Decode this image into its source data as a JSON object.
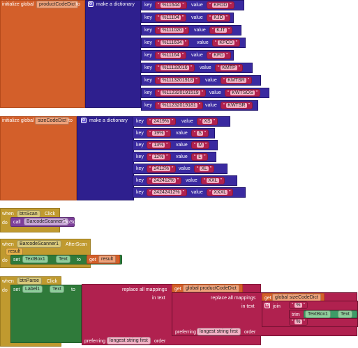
{
  "block1": {
    "initialize": "initialize global",
    "var_name": "productCodeDict",
    "to": "to",
    "make_dict": "make a dictionary",
    "pairs": [
      {
        "key": "%11644",
        "value": "KFDD"
      },
      {
        "key": "%11104",
        "value": "KJD"
      },
      {
        "key": "%111020",
        "value": "KJT"
      },
      {
        "key": "%111634",
        "value": "KPCD"
      },
      {
        "key": "%11164",
        "value": "KFD"
      },
      {
        "key": "%11132016",
        "value": "KMTP"
      },
      {
        "key": "%1113201918",
        "value": "KMTSR"
      },
      {
        "key": "%112320191519",
        "value": "KWTSOS"
      },
      {
        "key": "%11232019181",
        "value": "KWTSR"
      }
    ]
  },
  "block2": {
    "initialize": "initialize global",
    "var_name": "sizeCodeDict",
    "to": "to",
    "make_dict": "make a dictionary",
    "pairs": [
      {
        "key": "2419%",
        "value": "XS"
      },
      {
        "key": "19%",
        "value": "S"
      },
      {
        "key": "13%",
        "value": "M"
      },
      {
        "key": "12%",
        "value": "L"
      },
      {
        "key": "2412%",
        "value": "XL"
      },
      {
        "key": "242412%",
        "value": "XXL"
      },
      {
        "key": "24242412%",
        "value": "XXXL"
      }
    ]
  },
  "labels": {
    "key": "key",
    "value": "value"
  },
  "block3": {
    "when": "when",
    "component": "btnScan",
    "event": "Click",
    "do": "do",
    "call": "call",
    "scanner": "BarcodeScanner1",
    "method": "DoScan"
  },
  "block4": {
    "when": "when",
    "component": "BarcodeScanner1",
    "event": "AfterScan",
    "param": "result",
    "do": "do",
    "set": "set",
    "target": "TextBox1",
    "prop": "Text",
    "to": "to",
    "get": "get",
    "get_var": "result"
  },
  "block5": {
    "when": "when",
    "component": "btnParse",
    "event": "Click",
    "do": "do",
    "set": "set",
    "target": "Label1",
    "prop": "Text",
    "to": "to",
    "replace1": "replace all mappings",
    "get1": "get",
    "get1_var": "global productCodeDict",
    "in_text": "in text",
    "replace2": "replace all mappings",
    "get2": "get",
    "get2_var": "global sizeCodeDict",
    "in_text2": "in text",
    "join": "join",
    "join_str1": "%",
    "trim": "trim",
    "trim_target": "TextBox1",
    "trim_prop": "Text",
    "join_str2": "%",
    "preferring": "preferring",
    "pref_val": "longest string first",
    "order": "order",
    "preferring2": "preferring",
    "pref_val2": "longest string first",
    "order2": "order"
  },
  "colors": {
    "variable": "#d35f2a",
    "dictionary": "#2e1f8e",
    "event": "#c09a2f",
    "text": "#b0214f",
    "component": "#2f7a3a"
  }
}
